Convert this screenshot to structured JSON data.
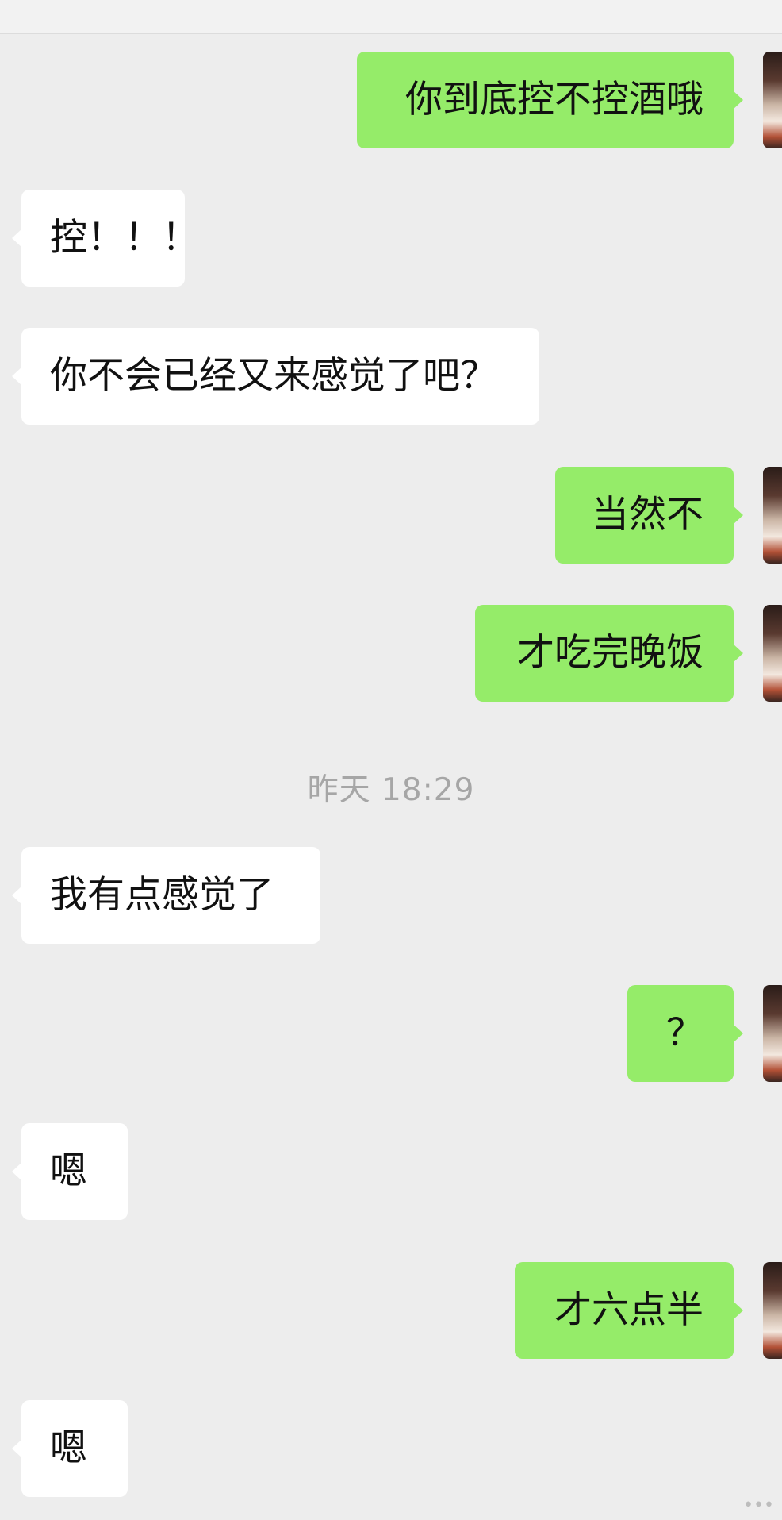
{
  "messages": [
    {
      "side": "right",
      "text": "你到底控不控酒哦"
    },
    {
      "side": "left",
      "text": "控！！！"
    },
    {
      "side": "left",
      "text": "你不会已经又来感觉了吧？"
    },
    {
      "side": "right",
      "text": "当然不"
    },
    {
      "side": "right",
      "text": "才吃完晚饭"
    },
    {
      "side": "left",
      "text": "我有点感觉了"
    },
    {
      "side": "right",
      "text": "？"
    },
    {
      "side": "left",
      "text": "嗯"
    },
    {
      "side": "right",
      "text": "才六点半"
    },
    {
      "side": "left",
      "text": "嗯"
    }
  ],
  "timestamp": "昨天 18:29",
  "watermark": "•••",
  "colors": {
    "background": "#ededed",
    "incoming_bubble": "#ffffff",
    "outgoing_bubble": "#95ec69",
    "timestamp_text": "#a6a6a6"
  }
}
